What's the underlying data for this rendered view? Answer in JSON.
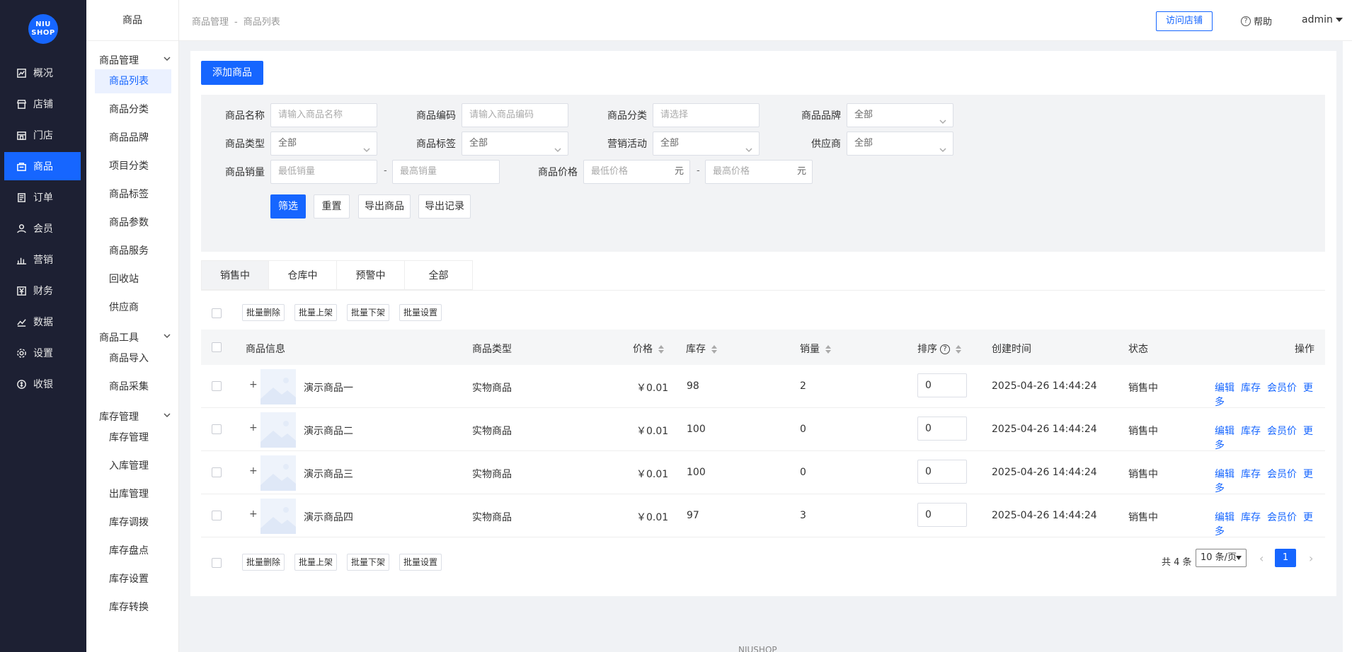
{
  "logo": {
    "line1": "NIU",
    "line2": "SHOP"
  },
  "rail": [
    {
      "label": "概况",
      "icon": "chart-line-icon",
      "active": false
    },
    {
      "label": "店铺",
      "icon": "store-icon",
      "active": false
    },
    {
      "label": "门店",
      "icon": "shop-front-icon",
      "active": false
    },
    {
      "label": "商品",
      "icon": "shopping-bag-icon",
      "active": true
    },
    {
      "label": "订单",
      "icon": "order-list-icon",
      "active": false
    },
    {
      "label": "会员",
      "icon": "user-icon",
      "active": false
    },
    {
      "label": "营销",
      "icon": "bar-chart-icon",
      "active": false
    },
    {
      "label": "财务",
      "icon": "yen-icon",
      "active": false
    },
    {
      "label": "数据",
      "icon": "data-chart-icon",
      "active": false
    },
    {
      "label": "设置",
      "icon": "gear-icon",
      "active": false
    },
    {
      "label": "收银",
      "icon": "cashier-icon",
      "active": false
    }
  ],
  "submenu": {
    "title": "商品",
    "groups": [
      {
        "label": "商品管理",
        "items": [
          "商品列表",
          "商品分类",
          "商品品牌",
          "项目分类",
          "商品标签",
          "商品参数",
          "商品服务",
          "回收站",
          "供应商"
        ]
      },
      {
        "label": "商品工具",
        "items": [
          "商品导入",
          "商品采集"
        ]
      },
      {
        "label": "库存管理",
        "items": [
          "库存管理",
          "入库管理",
          "出库管理",
          "库存调拨",
          "库存盘点",
          "库存设置",
          "库存转换"
        ]
      }
    ],
    "active_item": "商品列表"
  },
  "header": {
    "breadcrumb": [
      "商品管理",
      "商品列表"
    ],
    "breadcrumb_sep": "-",
    "visit_store": "访问店铺",
    "help": "帮助",
    "user": "admin"
  },
  "add_button": "添加商品",
  "filters": {
    "name": {
      "label": "商品名称",
      "placeholder": "请输入商品名称"
    },
    "code": {
      "label": "商品编码",
      "placeholder": "请输入商品编码"
    },
    "category": {
      "label": "商品分类",
      "placeholder": "请选择"
    },
    "brand": {
      "label": "商品品牌",
      "value": "全部"
    },
    "type": {
      "label": "商品类型",
      "value": "全部"
    },
    "tag": {
      "label": "商品标签",
      "value": "全部"
    },
    "activity": {
      "label": "营销活动",
      "value": "全部"
    },
    "supplier": {
      "label": "供应商",
      "value": "全部"
    },
    "sales": {
      "label": "商品销量",
      "min_placeholder": "最低销量",
      "max_placeholder": "最高销量"
    },
    "price": {
      "label": "商品价格",
      "min_placeholder": "最低价格",
      "max_placeholder": "最高价格",
      "unit": "元"
    },
    "range_sep": "-",
    "buttons": {
      "filter": "筛选",
      "reset": "重置",
      "export": "导出商品",
      "export_log": "导出记录"
    }
  },
  "tabs": [
    "销售中",
    "仓库中",
    "预警中",
    "全部"
  ],
  "batch": [
    "批量删除",
    "批量上架",
    "批量下架",
    "批量设置"
  ],
  "table": {
    "columns": {
      "info": "商品信息",
      "type": "商品类型",
      "price": "价格",
      "stock": "库存",
      "sales": "销量",
      "sort": "排序",
      "created": "创建时间",
      "status": "状态",
      "ops": "操作"
    },
    "rows": [
      {
        "name": "演示商品一",
        "type": "实物商品",
        "price": "￥0.01",
        "stock": "98",
        "sales": "2",
        "sort": "0",
        "created": "2025-04-26 14:44:24",
        "status": "销售中"
      },
      {
        "name": "演示商品二",
        "type": "实物商品",
        "price": "￥0.01",
        "stock": "100",
        "sales": "0",
        "sort": "0",
        "created": "2025-04-26 14:44:24",
        "status": "销售中"
      },
      {
        "name": "演示商品三",
        "type": "实物商品",
        "price": "￥0.01",
        "stock": "100",
        "sales": "0",
        "sort": "0",
        "created": "2025-04-26 14:44:24",
        "status": "销售中"
      },
      {
        "name": "演示商品四",
        "type": "实物商品",
        "price": "￥0.01",
        "stock": "97",
        "sales": "3",
        "sort": "0",
        "created": "2025-04-26 14:44:24",
        "status": "销售中"
      }
    ],
    "ops": [
      "编辑",
      "库存",
      "会员价",
      "更多"
    ],
    "plus": "+"
  },
  "pagination": {
    "total": "共 4 条",
    "page_size": "10 条/页",
    "current": "1"
  },
  "footer": "NIUSHOP",
  "colors": {
    "primary": "#1666ff",
    "rail_bg": "#1d2033"
  }
}
